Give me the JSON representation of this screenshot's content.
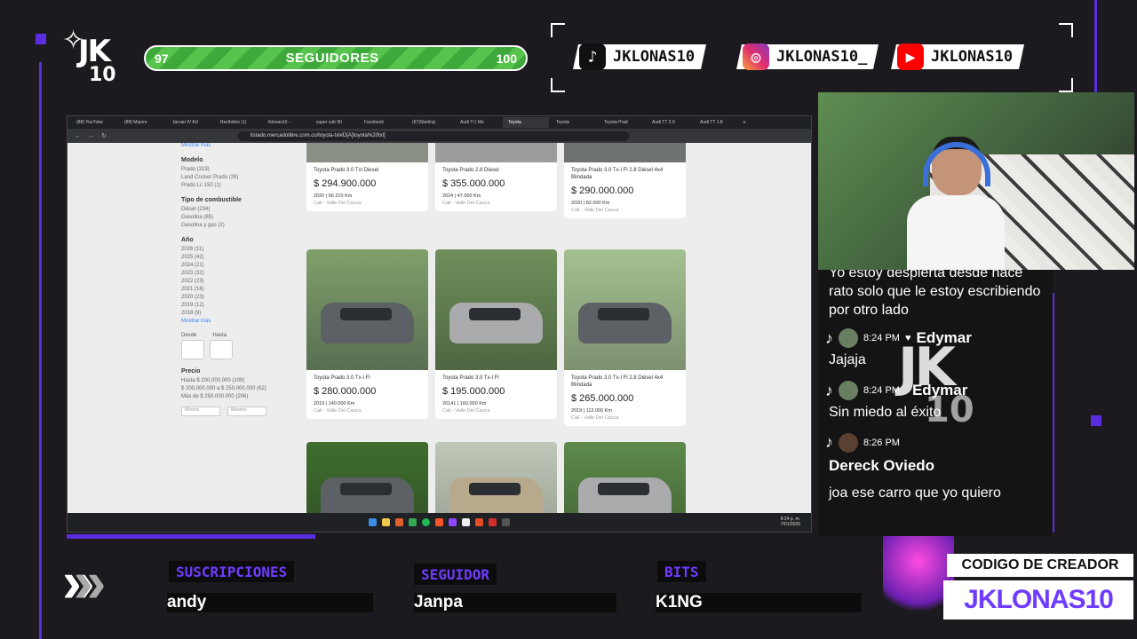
{
  "overlay": {
    "logo": {
      "line1": "JK",
      "line2": "10"
    },
    "followers": {
      "current": "97",
      "title": "SEGUIDORES",
      "goal": "100",
      "progress": 0.97
    },
    "socials": [
      {
        "platform": "tiktok",
        "icon": "tiktok-icon",
        "handle": "JKLONAS10"
      },
      {
        "platform": "instagram",
        "icon": "instagram-icon",
        "handle": "JKLONAS10_"
      },
      {
        "platform": "youtube",
        "icon": "youtube-icon",
        "handle": "JKLONAS10"
      }
    ],
    "accent": "#5a2ee0"
  },
  "browser": {
    "tabs": [
      "(88) YouTube",
      "(88) Mejore",
      "Jarvan IV AU",
      "Recibidos (1)",
      "Iklonas10 –",
      "super cub 90",
      "Facebook",
      "(67)Sterling",
      "Audi Tt | Mo",
      "Toyota",
      "Toyota",
      "Toyota Prad",
      "Audi TT 2.0",
      "Audi TT 1.8"
    ],
    "url": "listado.mercadolibre.com.co/toyota-txl#D[A]toyota%20txl]",
    "filters": {
      "top_more": "Mostrar más",
      "modelo": {
        "title": "Modelo",
        "items": [
          "Prado (323)",
          "Land Cruiser Prado (26)",
          "Prado Lc 150 (1)"
        ]
      },
      "combustible": {
        "title": "Tipo de combustible",
        "items": [
          "Diésel (234)",
          "Gasolina (85)",
          "Gasolina y gas (2)"
        ]
      },
      "anio": {
        "title": "Año",
        "items": [
          "2026 (11)",
          "2025 (42)",
          "2024 (21)",
          "2023 (32)",
          "2022 (23)",
          "2021 (16)",
          "2020 (23)",
          "2019 (12)",
          "2018 (9)"
        ],
        "more": "Mostrar más"
      },
      "range": {
        "from": "Desde",
        "to": "Hasta"
      },
      "precio": {
        "title": "Precio",
        "items": [
          "Hasta $ 200.000.000 (109)",
          "$ 200.000.000 a $ 250.000.000 (62)",
          "Más de $ 250.000.000 (206)"
        ],
        "min": "Mínimo",
        "max": "Máximo"
      }
    },
    "listings": [
      {
        "name": "Toyota Prado 3.0 Txl Diesel",
        "price": "$ 294.900.000",
        "km": "2020 | 66.210 Km",
        "loc": "Cali - Valle Del Cauca"
      },
      {
        "name": "Toyota Prado 2.8 Diesel",
        "price": "$ 355.000.000",
        "km": "2024 | 47.000 Km",
        "loc": "Cali - Valle Del Cauca"
      },
      {
        "name": "Toyota Prado 3.0 Tx-l Fl 2.8 Diésel 4x4 Blindada",
        "price": "$ 290.000.000",
        "km": "2020 | 82.000 Km",
        "loc": "Cali - Valle Del Cauca"
      },
      {
        "name": "Toyota Prado 3.0 Tx-l Fl",
        "price": "$ 280.000.000",
        "km": "2019 | 140.000 Km",
        "loc": "Cali - Valle Del Cauca"
      },
      {
        "name": "Toyota Prado 3.0 Tx-l Fl",
        "price": "$ 195.000.000",
        "km": "20141 | 160.000 Km",
        "loc": "Cali - Valle Del Cauca"
      },
      {
        "name": "Toyota Prado 3.0 Tx-l Fl 2.8 Diésel 4x4 Blindada",
        "price": "$ 265.000.000",
        "km": "2019 | 112.000 Km",
        "loc": "Cali - Valle Del Cauca"
      }
    ],
    "clock": {
      "time": "8:24 p. m.",
      "date": "7/01/2026"
    }
  },
  "chat": {
    "partial_message": "Yo estoy despierta desde hace rato solo que le estoy escribiendo por otro lado",
    "messages": [
      {
        "time": "8:24 PM",
        "user": "Edymar",
        "text": "Jajaja"
      },
      {
        "time": "8:24 PM",
        "user": "Edymar",
        "text": "Sin miedo al éxito"
      },
      {
        "time": "8:26 PM",
        "user": "Dereck Oviedo",
        "text": "joa ese carro que yo quiero"
      }
    ]
  },
  "bottom": {
    "subs_label": "SUSCRIPCIONES",
    "subs_value": "andy",
    "follower_label": "SEGUIDOR",
    "follower_value": "Janpa",
    "bits_label": "BITS",
    "bits_value": "K1NG",
    "creator_label": "CODIGO DE CREADOR",
    "creator_code": "JKLONAS10"
  }
}
